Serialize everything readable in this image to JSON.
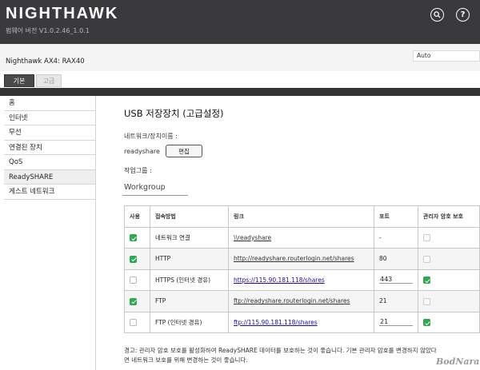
{
  "header": {
    "brand": "NIGHTHAWK",
    "firmware": "펌웨어 버전 V1.0.2.46_1.0.1",
    "model": "Nighthawk AX4: RAX40",
    "language": "Auto",
    "icons": [
      "search-icon",
      "help-icon"
    ]
  },
  "tabs": [
    {
      "label": "기본",
      "active": true
    },
    {
      "label": "고급",
      "active": false
    }
  ],
  "sidebar": {
    "items": [
      {
        "label": "홈"
      },
      {
        "label": "인터넷"
      },
      {
        "label": "무선"
      },
      {
        "label": "연결된 장치"
      },
      {
        "label": "QoS"
      },
      {
        "label": "ReadySHARE",
        "active": true
      },
      {
        "label": "게스트 네트워크"
      }
    ]
  },
  "main": {
    "title": "USB 저장장치 (고급설정)",
    "network_label": "네트워크/장치이름 :",
    "device_name": "readyshare",
    "edit_label": "편집",
    "workgroup_label": "작업그룹 :",
    "workgroup_value": "Workgroup",
    "table": {
      "headers": [
        "사용",
        "접속방법",
        "링크",
        "포트",
        "관리자 암호 보호"
      ],
      "rows": [
        {
          "use": true,
          "method": "네트워크 연결",
          "link": "\\\\readyshare",
          "link_style": "plain",
          "port": "-",
          "port_input": false,
          "protect": false,
          "protect_disabled": true
        },
        {
          "use": true,
          "method": "HTTP",
          "link": "http://readyshare.routerlogin.net/shares",
          "link_style": "plain",
          "port": "80",
          "port_input": false,
          "protect": false,
          "protect_disabled": true
        },
        {
          "use": false,
          "method": "HTTPS (인터넷 경유)",
          "link": "https://115.90.181.118/shares",
          "link_style": "blue",
          "port": "443",
          "port_input": true,
          "protect": true,
          "protect_disabled": false
        },
        {
          "use": true,
          "method": "FTP",
          "link": "ftp://readyshare.routerlogin.net/shares",
          "link_style": "plain",
          "port": "21",
          "port_input": false,
          "protect": false,
          "protect_disabled": true
        },
        {
          "use": false,
          "method": "FTP (인터넷 경유)",
          "link": "ftp://115.90.181.118/shares",
          "link_style": "blue",
          "port": "21",
          "port_input": true,
          "protect": true,
          "protect_disabled": false
        }
      ]
    },
    "warning_line1": "경고: 관리자 암호 보호를 활성화하여 ReadySHARE 데이터를 보호하는 것이 좋습니다. 기본 관리자 암호를 변경하지 않았다",
    "warning_line2": "면 네트워크 보호를 위해 변경하는 것이 좋습니다."
  },
  "watermark": "BodNara",
  "colors": {
    "topbar": "#3a3a3d",
    "accent_green": "#2fa84f",
    "link_blue": "#1a0dab"
  }
}
